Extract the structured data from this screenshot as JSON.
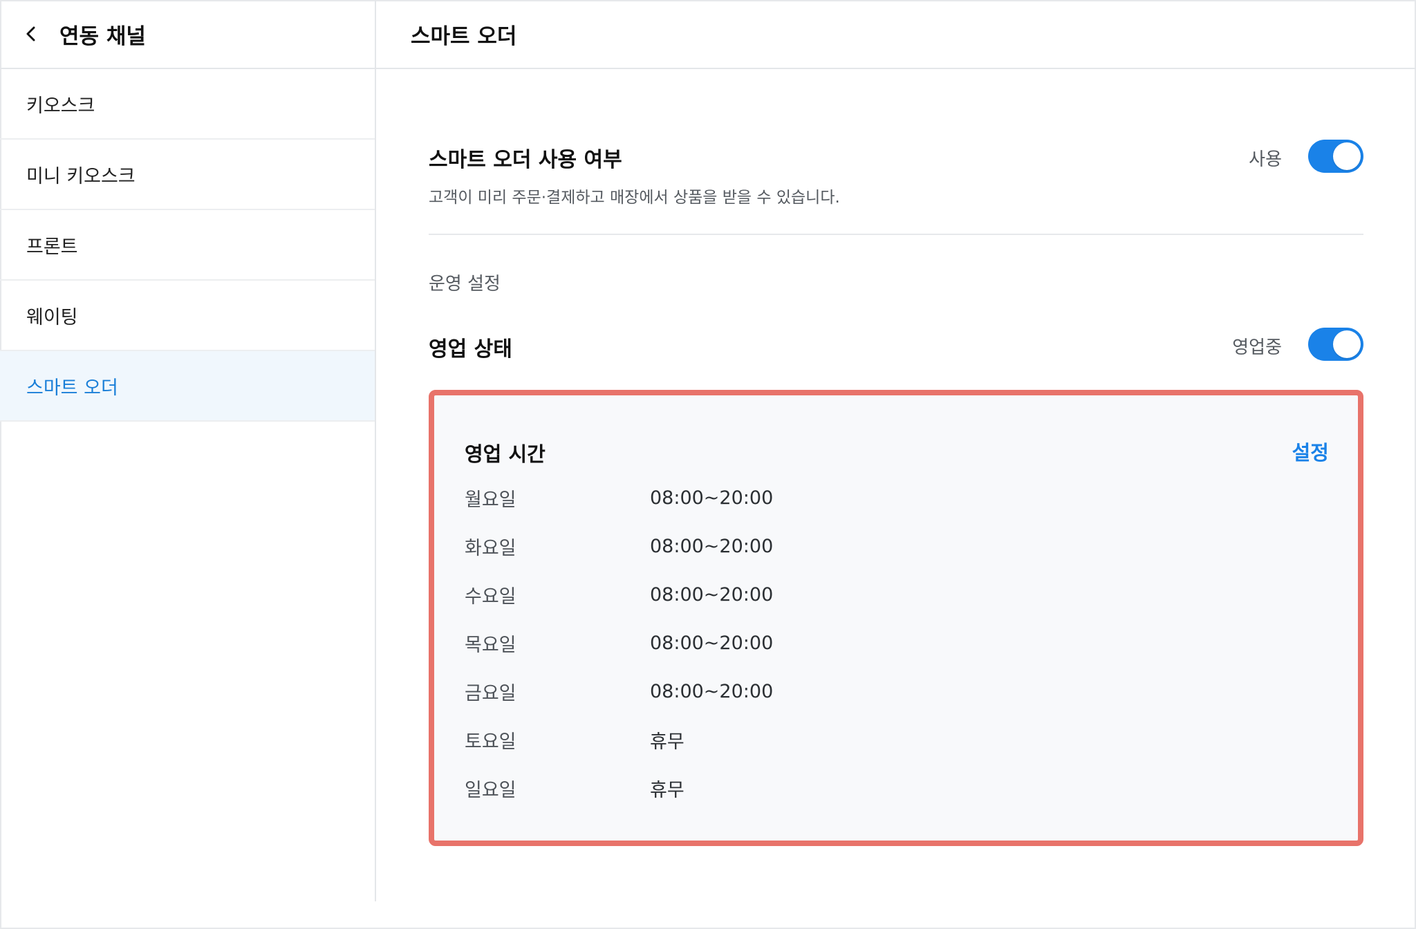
{
  "sidebar": {
    "title": "연동 채널",
    "items": [
      {
        "label": "키오스크",
        "active": false
      },
      {
        "label": "미니 키오스크",
        "active": false
      },
      {
        "label": "프론트",
        "active": false
      },
      {
        "label": "웨이팅",
        "active": false
      },
      {
        "label": "스마트 오더",
        "active": true
      }
    ]
  },
  "main": {
    "title": "스마트 오더",
    "usage": {
      "title": "스마트 오더 사용 여부",
      "description": "고객이 미리 주문·결제하고 매장에서 상품을 받을 수 있습니다.",
      "toggle_label": "사용",
      "enabled": true
    },
    "section_label": "운영 설정",
    "status": {
      "title": "영업 상태",
      "toggle_label": "영업중",
      "enabled": true
    },
    "hours": {
      "title": "영업 시간",
      "set_label": "설정",
      "days": [
        {
          "day": "월요일",
          "time": "08:00~20:00"
        },
        {
          "day": "화요일",
          "time": "08:00~20:00"
        },
        {
          "day": "수요일",
          "time": "08:00~20:00"
        },
        {
          "day": "목요일",
          "time": "08:00~20:00"
        },
        {
          "day": "금요일",
          "time": "08:00~20:00"
        },
        {
          "day": "토요일",
          "time": "휴무"
        },
        {
          "day": "일요일",
          "time": "휴무"
        }
      ]
    }
  },
  "colors": {
    "accent": "#1a82e8",
    "highlight_border": "#e8736a",
    "active_bg": "#f0f7fd"
  }
}
